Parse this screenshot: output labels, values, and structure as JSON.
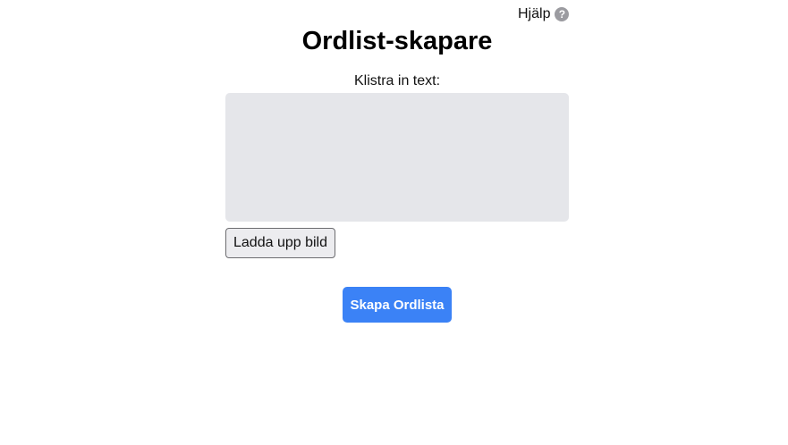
{
  "help": {
    "label": "Hjälp",
    "icon": "question-circle-icon",
    "icon_glyph": "?"
  },
  "title": "Ordlist-skapare",
  "text_input": {
    "label": "Klistra in text:",
    "value": "",
    "placeholder": ""
  },
  "upload_button": {
    "label": "Ladda upp bild"
  },
  "create_button": {
    "label": "Skapa Ordlista"
  },
  "colors": {
    "accent": "#3b82f6",
    "input_background": "#e5e6ea",
    "help_icon": "#9b9ba0"
  }
}
